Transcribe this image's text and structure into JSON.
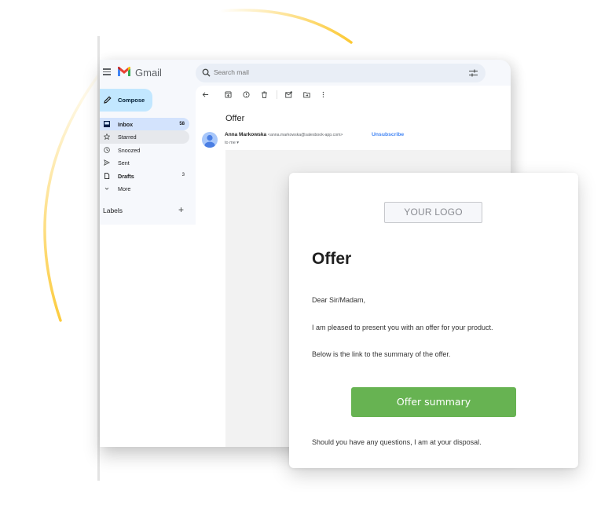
{
  "gmail": {
    "wordmark": "Gmail",
    "search": {
      "placeholder": "Search mail"
    },
    "compose_label": "Compose",
    "nav": [
      {
        "label": "Inbox",
        "count": "58",
        "icon": "inbox-icon",
        "state": "active",
        "bold": true
      },
      {
        "label": "Starred",
        "count": "",
        "icon": "star-icon",
        "state": "hover",
        "bold": false
      },
      {
        "label": "Snoozed",
        "count": "",
        "icon": "clock-icon",
        "state": "",
        "bold": false
      },
      {
        "label": "Sent",
        "count": "",
        "icon": "send-icon",
        "state": "",
        "bold": false
      },
      {
        "label": "Drafts",
        "count": "3",
        "icon": "draft-icon",
        "state": "",
        "bold": true
      },
      {
        "label": "More",
        "count": "",
        "icon": "chevron-down-icon",
        "state": "",
        "bold": false
      }
    ],
    "labels_heading": "Labels",
    "labels_add": "+",
    "toolbar": [
      "back-arrow-icon",
      "archive-icon",
      "report-spam-icon",
      "delete-icon",
      "mark-unread-icon",
      "move-to-icon",
      "more-vert-icon"
    ],
    "message": {
      "subject": "Offer",
      "sender_name": "Anna Markowska",
      "sender_email": "<anna.markowska@salesbook-app.com>",
      "unsubscribe": "Unsubscribe",
      "to": "to me ▾"
    }
  },
  "email_card": {
    "logo_placeholder": "YOUR LOGO",
    "title": "Offer",
    "greeting": "Dear Sir/Madam,",
    "paragraph_1": "I am pleased to present you with an offer for your product.",
    "paragraph_2": "Below is the link to the summary of the offer.",
    "cta_label": "Offer summary",
    "closing": "Should you have any questions, I am at your disposal."
  },
  "colors": {
    "accent_arc": "#fcc934",
    "cta_green": "#67b352",
    "compose_blue": "#c2e7ff",
    "inbox_active": "#d3e3fd",
    "link_blue": "#4285f4"
  }
}
